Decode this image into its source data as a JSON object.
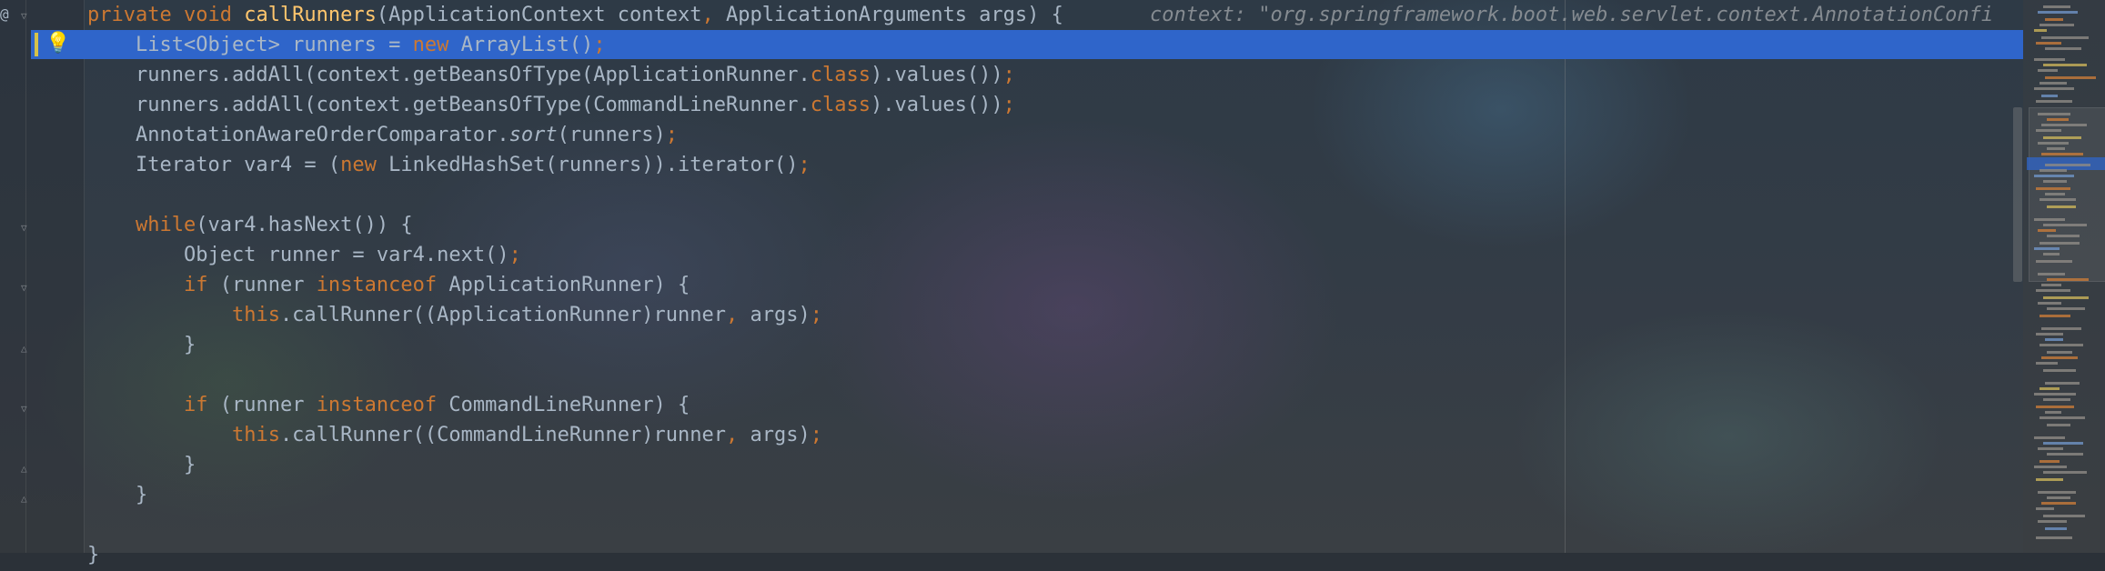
{
  "editor": {
    "inline_hint": "context: \"org.springframework.boot.web.servlet.context.AnnotationConfi",
    "lines": [
      [
        {
          "t": "private ",
          "c": "kw"
        },
        {
          "t": "void ",
          "c": "kw"
        },
        {
          "t": "callRunners",
          "c": "fn"
        },
        {
          "t": "(ApplicationContext context"
        },
        {
          "t": ", ",
          "c": "kw"
        },
        {
          "t": "ApplicationArguments args) {"
        }
      ],
      [
        {
          "t": "    List<Object> runners = "
        },
        {
          "t": "new ",
          "c": "kw"
        },
        {
          "t": "ArrayList()"
        },
        {
          "t": ";",
          "c": "kw"
        }
      ],
      [
        {
          "t": "    runners.addAll(context.getBeansOfType(ApplicationRunner."
        },
        {
          "t": "class",
          "c": "kw"
        },
        {
          "t": ").values())"
        },
        {
          "t": ";",
          "c": "kw"
        }
      ],
      [
        {
          "t": "    runners.addAll(context.getBeansOfType(CommandLineRunner."
        },
        {
          "t": "class",
          "c": "kw"
        },
        {
          "t": ").values())"
        },
        {
          "t": ";",
          "c": "kw"
        }
      ],
      [
        {
          "t": "    AnnotationAwareOrderComparator."
        },
        {
          "t": "sort",
          "c": "it"
        },
        {
          "t": "(runners)"
        },
        {
          "t": ";",
          "c": "kw"
        }
      ],
      [
        {
          "t": "    Iterator var4 = ("
        },
        {
          "t": "new ",
          "c": "kw"
        },
        {
          "t": "LinkedHashSet(runners)).iterator()"
        },
        {
          "t": ";",
          "c": "kw"
        }
      ],
      [
        {
          "t": ""
        }
      ],
      [
        {
          "t": "    "
        },
        {
          "t": "while",
          "c": "kw"
        },
        {
          "t": "(var4.hasNext()) {"
        }
      ],
      [
        {
          "t": "        Object runner = var4.next()"
        },
        {
          "t": ";",
          "c": "kw"
        }
      ],
      [
        {
          "t": "        "
        },
        {
          "t": "if ",
          "c": "kw"
        },
        {
          "t": "(runner "
        },
        {
          "t": "instanceof ",
          "c": "kw"
        },
        {
          "t": "ApplicationRunner) {"
        }
      ],
      [
        {
          "t": "            "
        },
        {
          "t": "this",
          "c": "kw"
        },
        {
          "t": ".callRunner((ApplicationRunner)runner"
        },
        {
          "t": ", ",
          "c": "kw"
        },
        {
          "t": "args)"
        },
        {
          "t": ";",
          "c": "kw"
        }
      ],
      [
        {
          "t": "        }"
        }
      ],
      [
        {
          "t": ""
        }
      ],
      [
        {
          "t": "        "
        },
        {
          "t": "if ",
          "c": "kw"
        },
        {
          "t": "(runner "
        },
        {
          "t": "instanceof ",
          "c": "kw"
        },
        {
          "t": "CommandLineRunner) {"
        }
      ],
      [
        {
          "t": "            "
        },
        {
          "t": "this",
          "c": "kw"
        },
        {
          "t": ".callRunner((CommandLineRunner)runner"
        },
        {
          "t": ", ",
          "c": "kw"
        },
        {
          "t": "args)"
        },
        {
          "t": ";",
          "c": "kw"
        }
      ],
      [
        {
          "t": "        }"
        }
      ],
      [
        {
          "t": "    }"
        }
      ],
      [
        {
          "t": ""
        }
      ],
      [
        {
          "t": "}"
        }
      ]
    ]
  },
  "gutter": {
    "at_marker": "@",
    "bulb_icon": "lightbulb-icon"
  },
  "colors": {
    "keyword": "#cc7832",
    "method": "#ffc66d",
    "text": "#a9b7c6",
    "hint": "#858b91",
    "selection": "#2f65ca"
  }
}
